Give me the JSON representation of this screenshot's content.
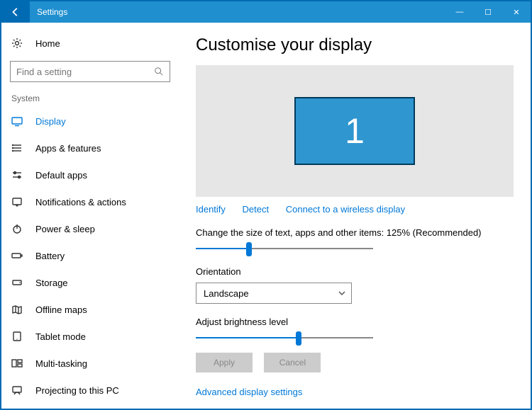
{
  "window": {
    "title": "Settings"
  },
  "sidebar": {
    "home": "Home",
    "search_placeholder": "Find a setting",
    "section": "System",
    "items": [
      {
        "label": "Display",
        "selected": true
      },
      {
        "label": "Apps & features"
      },
      {
        "label": "Default apps"
      },
      {
        "label": "Notifications & actions"
      },
      {
        "label": "Power & sleep"
      },
      {
        "label": "Battery"
      },
      {
        "label": "Storage"
      },
      {
        "label": "Offline maps"
      },
      {
        "label": "Tablet mode"
      },
      {
        "label": "Multi-tasking"
      },
      {
        "label": "Projecting to this PC"
      }
    ]
  },
  "content": {
    "title": "Customise your display",
    "monitor_number": "1",
    "links": {
      "identify": "Identify",
      "detect": "Detect",
      "wireless": "Connect to a wireless display"
    },
    "scale_label": "Change the size of text, apps and other items: 125% (Recommended)",
    "scale_percent": 30,
    "orientation_label": "Orientation",
    "orientation_value": "Landscape",
    "brightness_label": "Adjust brightness level",
    "brightness_percent": 58,
    "apply": "Apply",
    "cancel": "Cancel",
    "advanced": "Advanced display settings"
  }
}
